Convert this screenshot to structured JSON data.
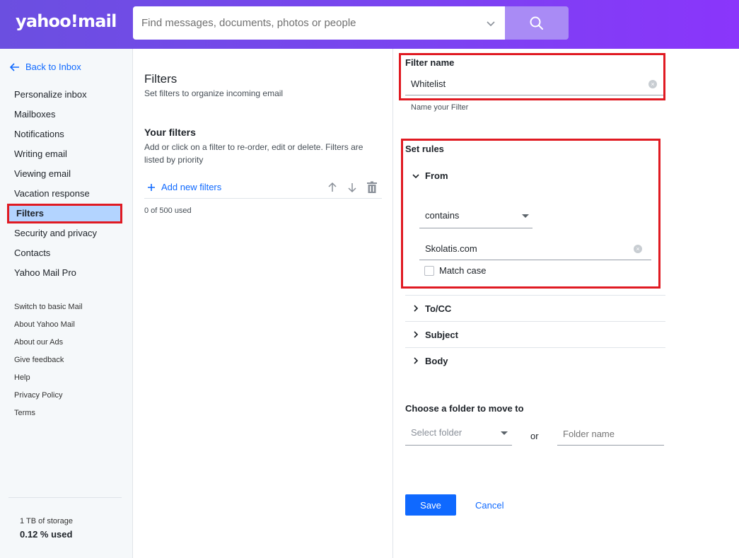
{
  "header": {
    "logo": "yahoo!mail",
    "search_placeholder": "Find messages, documents, photos or people"
  },
  "sidebar": {
    "back": "Back to Inbox",
    "items": [
      {
        "label": "Personalize inbox"
      },
      {
        "label": "Mailboxes"
      },
      {
        "label": "Notifications"
      },
      {
        "label": "Writing email"
      },
      {
        "label": "Viewing email"
      },
      {
        "label": "Vacation response"
      },
      {
        "label": "Filters",
        "active": true
      },
      {
        "label": "Security and privacy"
      },
      {
        "label": "Contacts"
      },
      {
        "label": "Yahoo Mail Pro"
      }
    ],
    "links": [
      "Switch to basic Mail",
      "About Yahoo Mail",
      "About our Ads",
      "Give feedback",
      "Help",
      "Privacy Policy",
      "Terms"
    ],
    "storage": "1 TB of storage",
    "storage_used": "0.12 % used"
  },
  "filters": {
    "title": "Filters",
    "subtitle": "Set filters to organize incoming email",
    "your_filters": "Your filters",
    "your_filters_desc": "Add or click on a filter to re-order, edit or delete. Filters are listed by priority",
    "add_new": "Add new filters",
    "usage": "0 of 500 used"
  },
  "editor": {
    "filter_name_label": "Filter name",
    "filter_name_value": "Whitelist",
    "filter_name_hint": "Name your Filter",
    "set_rules_label": "Set rules",
    "from_label": "From",
    "from_condition": "contains",
    "from_value": "Skolatis.com",
    "match_case": "Match case",
    "rules": [
      "To/CC",
      "Subject",
      "Body"
    ],
    "folder_label": "Choose a folder to move to",
    "folder_select_placeholder": "Select folder",
    "or": "or",
    "folder_name_placeholder": "Folder name",
    "save": "Save",
    "cancel": "Cancel"
  },
  "colors": {
    "accent": "#0f69ff",
    "highlight": "#e01a22",
    "active_bg": "#b3d4ff"
  }
}
